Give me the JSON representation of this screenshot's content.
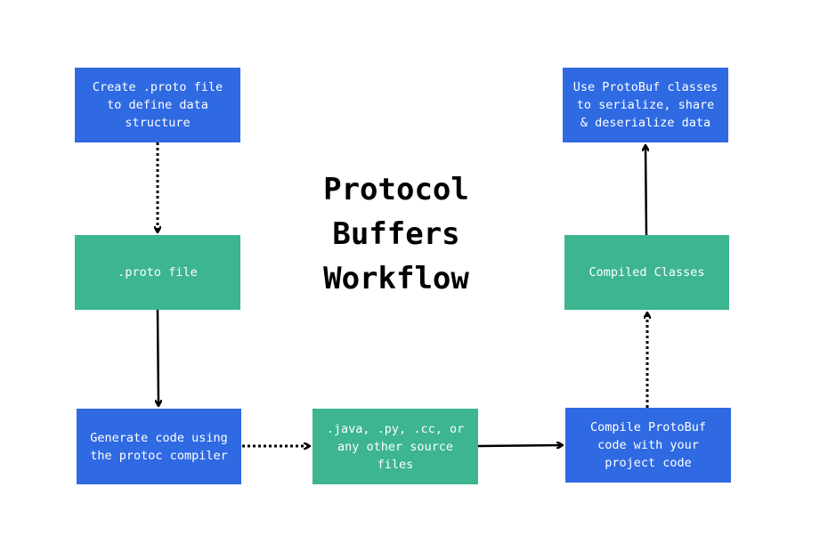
{
  "title": "Protocol\nBuffers\nWorkflow",
  "colors": {
    "blue": "#2f6ae3",
    "green": "#3db591",
    "arrow": "#000000",
    "background": "#ffffff"
  },
  "nodes": [
    {
      "id": "b1",
      "label": "Create .proto file\nto define data\nstructure",
      "color": "blue"
    },
    {
      "id": "b2",
      "label": ".proto file",
      "color": "green"
    },
    {
      "id": "b3",
      "label": "Generate code using\nthe protoc compiler",
      "color": "blue"
    },
    {
      "id": "b4",
      "label": ".java, .py, .cc, or\nany other source\nfiles",
      "color": "green"
    },
    {
      "id": "b5",
      "label": "Compile ProtoBuf\ncode with your\nproject code",
      "color": "blue"
    },
    {
      "id": "b6",
      "label": "Compiled Classes",
      "color": "green"
    },
    {
      "id": "b7",
      "label": "Use ProtoBuf classes\nto serialize, share\n& deserialize data",
      "color": "blue"
    }
  ],
  "edges": [
    {
      "from": "b1",
      "to": "b2",
      "style": "dotted"
    },
    {
      "from": "b2",
      "to": "b3",
      "style": "solid"
    },
    {
      "from": "b3",
      "to": "b4",
      "style": "dotted"
    },
    {
      "from": "b4",
      "to": "b5",
      "style": "solid"
    },
    {
      "from": "b5",
      "to": "b6",
      "style": "dotted"
    },
    {
      "from": "b6",
      "to": "b7",
      "style": "solid"
    }
  ]
}
